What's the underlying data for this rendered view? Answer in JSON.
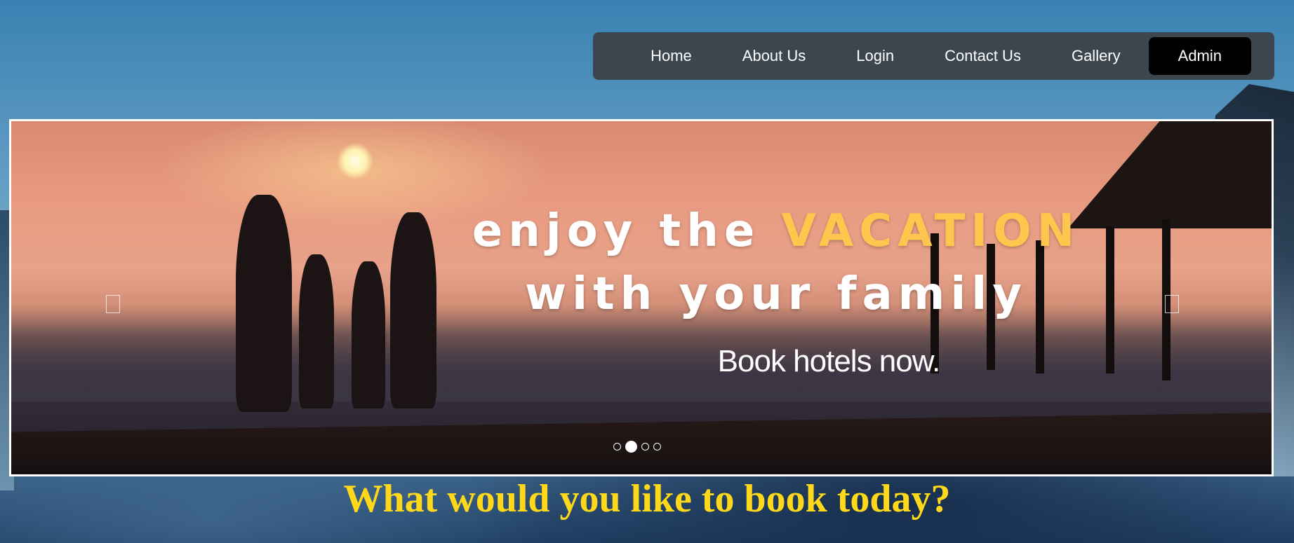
{
  "nav": {
    "items": [
      {
        "label": "Home",
        "active": false
      },
      {
        "label": "About Us",
        "active": false
      },
      {
        "label": "Login",
        "active": false
      },
      {
        "label": "Contact Us",
        "active": false
      },
      {
        "label": "Gallery",
        "active": false
      },
      {
        "label": "Admin",
        "active": true
      }
    ]
  },
  "hero": {
    "headline_line1_start": "ENJOY THE",
    "headline_line1_accent": "VACATION",
    "headline_line2": "WITH YOUR FAMILY",
    "subheadline": "Book hotels now.",
    "indicators": {
      "count": 4,
      "active_index": 1
    },
    "prev_icon": "chevron-left-icon",
    "next_icon": "chevron-right-icon"
  },
  "prompt": {
    "text": "What would you like to book today?"
  },
  "colors": {
    "navbar_bg": "#3c464e",
    "nav_active_bg": "#000000",
    "headline_accent": "#ffc64d",
    "prompt_text": "#ffd81a"
  }
}
